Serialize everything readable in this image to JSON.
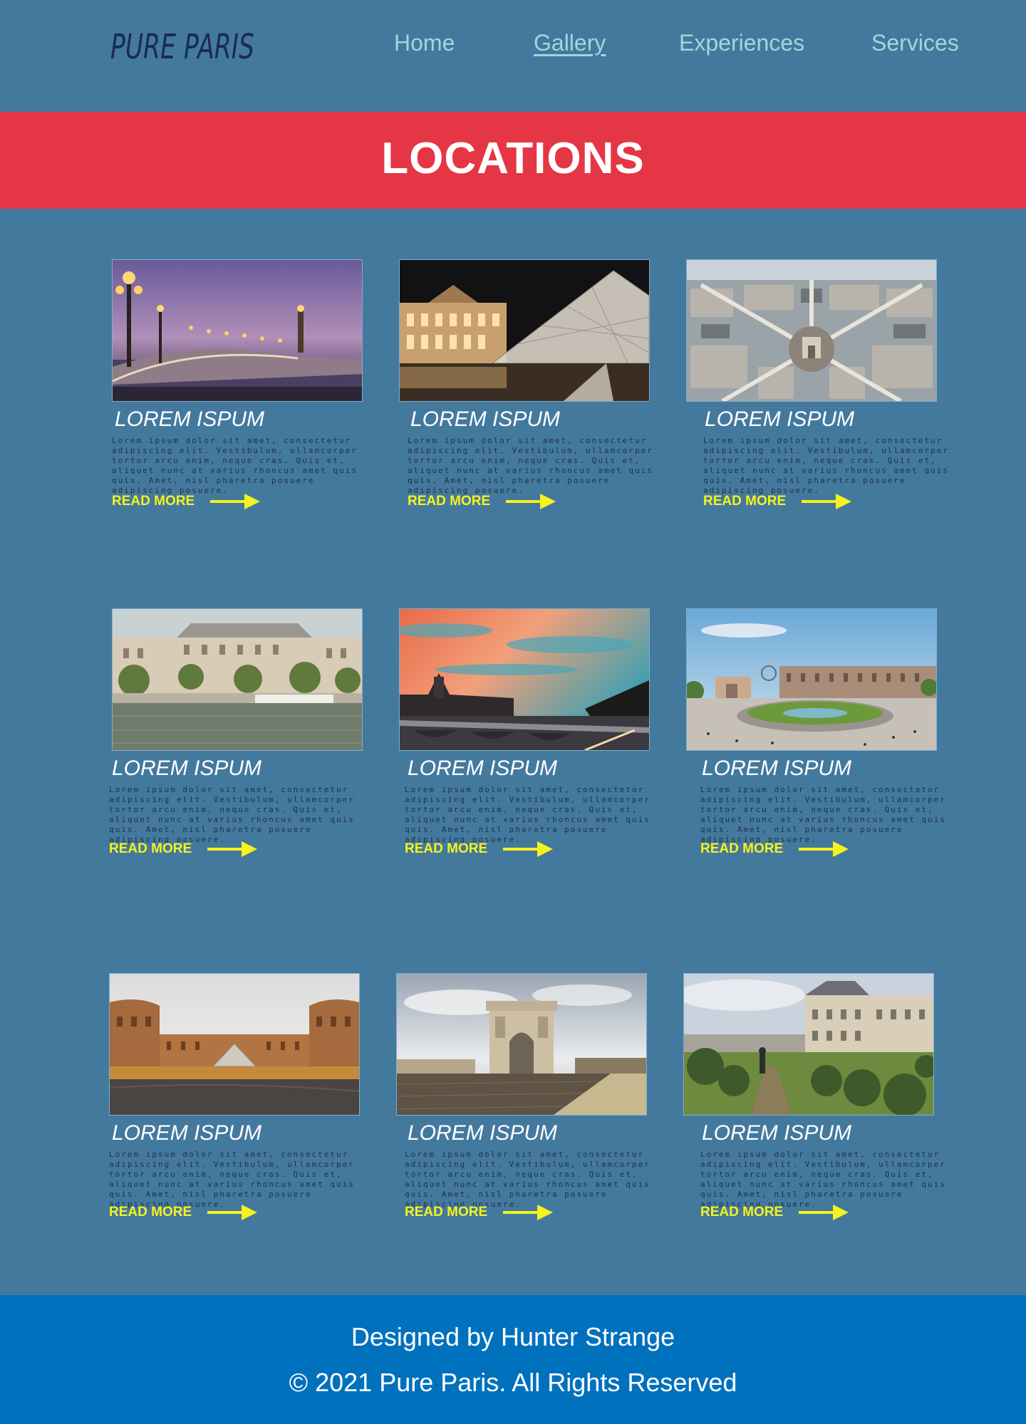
{
  "header": {
    "logo": "PURE PARIS",
    "nav": [
      {
        "label": "Home",
        "active": false
      },
      {
        "label": "Gallery",
        "active": true
      },
      {
        "label": "Experiences",
        "active": false
      },
      {
        "label": "Services",
        "active": false
      }
    ]
  },
  "banner": {
    "title": "LOCATIONS"
  },
  "cards": [
    {
      "image": "alexandre-iii-bridge-dusk-photo",
      "title": "LOREM ISPUM",
      "body": "Lorem ipsum dolor sit amet, consectetur adipiscing elit. Vestibulum, ullamcorper tortor arcu enim, neque cras. Quis et, aliquet nunc at varius rhoncus amet quis quis. Amet, nisl pharetra posuere adipiscing posuere.",
      "read_more": "READ MORE"
    },
    {
      "image": "louvre-pyramid-night-photo",
      "title": "LOREM ISPUM",
      "body": "Lorem ipsum dolor sit amet, consectetur adipiscing elit. Vestibulum, ullamcorper tortor arcu enim, neque cras. Quis et, aliquet nunc at varius rhoncus amet quis quis. Amet, nisl pharetra posuere adipiscing posuere.",
      "read_more": "READ MORE"
    },
    {
      "image": "arc-de-triomphe-aerial-photo",
      "title": "LOREM ISPUM",
      "body": "Lorem ipsum dolor sit amet, consectetur adipiscing elit. Vestibulum, ullamcorper tortor arcu enim, neque cras. Quis et, aliquet nunc at varius rhoncus amet quis quis. Amet, nisl pharetra posuere adipiscing posuere.",
      "read_more": "READ MORE"
    },
    {
      "image": "seine-riverbank-buildings-photo",
      "title": "LOREM ISPUM",
      "body": "Lorem ipsum dolor sit amet, consectetur adipiscing elit. Vestibulum, ullamcorper tortor arcu enim, neque cras. Quis et, aliquet nunc at varius rhoncus amet quis quis. Amet, nisl pharetra posuere adipiscing posuere.",
      "read_more": "READ MORE"
    },
    {
      "image": "conciergerie-sunset-photo",
      "title": "LOREM ISPUM",
      "body": "Lorem ipsum dolor sit amet, consectetur adipiscing elit. Vestibulum, ullamcorper tortor arcu enim, neque cras. Quis et, aliquet nunc at varius rhoncus amet quis quis. Amet, nisl pharetra posuere adipiscing posuere.",
      "read_more": "READ MORE"
    },
    {
      "image": "tuileries-garden-plaza-photo",
      "title": "LOREM ISPUM",
      "body": "Lorem ipsum dolor sit amet, consectetur adipiscing elit. Vestibulum, ullamcorper tortor arcu enim, neque cras. Quis et, aliquet nunc at varius rhoncus amet quis quis. Amet, nisl pharetra posuere adipiscing posuere.",
      "read_more": "READ MORE"
    },
    {
      "image": "louvre-courtyard-photo",
      "title": "LOREM ISPUM",
      "body": "Lorem ipsum dolor sit amet, consectetur adipiscing elit. Vestibulum, ullamcorper tortor arcu enim, neque cras. Quis et, aliquet nunc at varius rhoncus amet quis quis. Amet, nisl pharetra posuere adipiscing posuere.",
      "read_more": "READ MORE"
    },
    {
      "image": "arc-de-triomphe-street-photo",
      "title": "LOREM ISPUM",
      "body": "Lorem ipsum dolor sit amet, consectetur adipiscing elit. Vestibulum, ullamcorper tortor arcu enim, neque cras. Quis et, aliquet nunc at varius rhoncus amet quis quis. Amet, nisl pharetra posuere adipiscing posuere.",
      "read_more": "READ MORE"
    },
    {
      "image": "tuileries-garden-palace-photo",
      "title": "LOREM ISPUM",
      "body": "Lorem ipsum dolor sit amet, consectetur adipiscing elit. Vestibulum, ullamcorper tortor arcu enim, neque cras. Quis et, aliquet nunc at varius rhoncus amet quis quis. Amet, nisl pharetra posuere adipiscing posuere.",
      "read_more": "READ MORE"
    }
  ],
  "footer": {
    "designed_by": "Designed by Hunter Strange",
    "copyright": "© 2021 Pure Paris. All Rights Reserved"
  },
  "colors": {
    "page_bg": "#44799e",
    "banner_bg": "#e53646",
    "nav_text": "#9fd8dc",
    "logo_text": "#1b2b52",
    "read_more": "#f6f21d",
    "footer_bg": "#0071bd"
  }
}
